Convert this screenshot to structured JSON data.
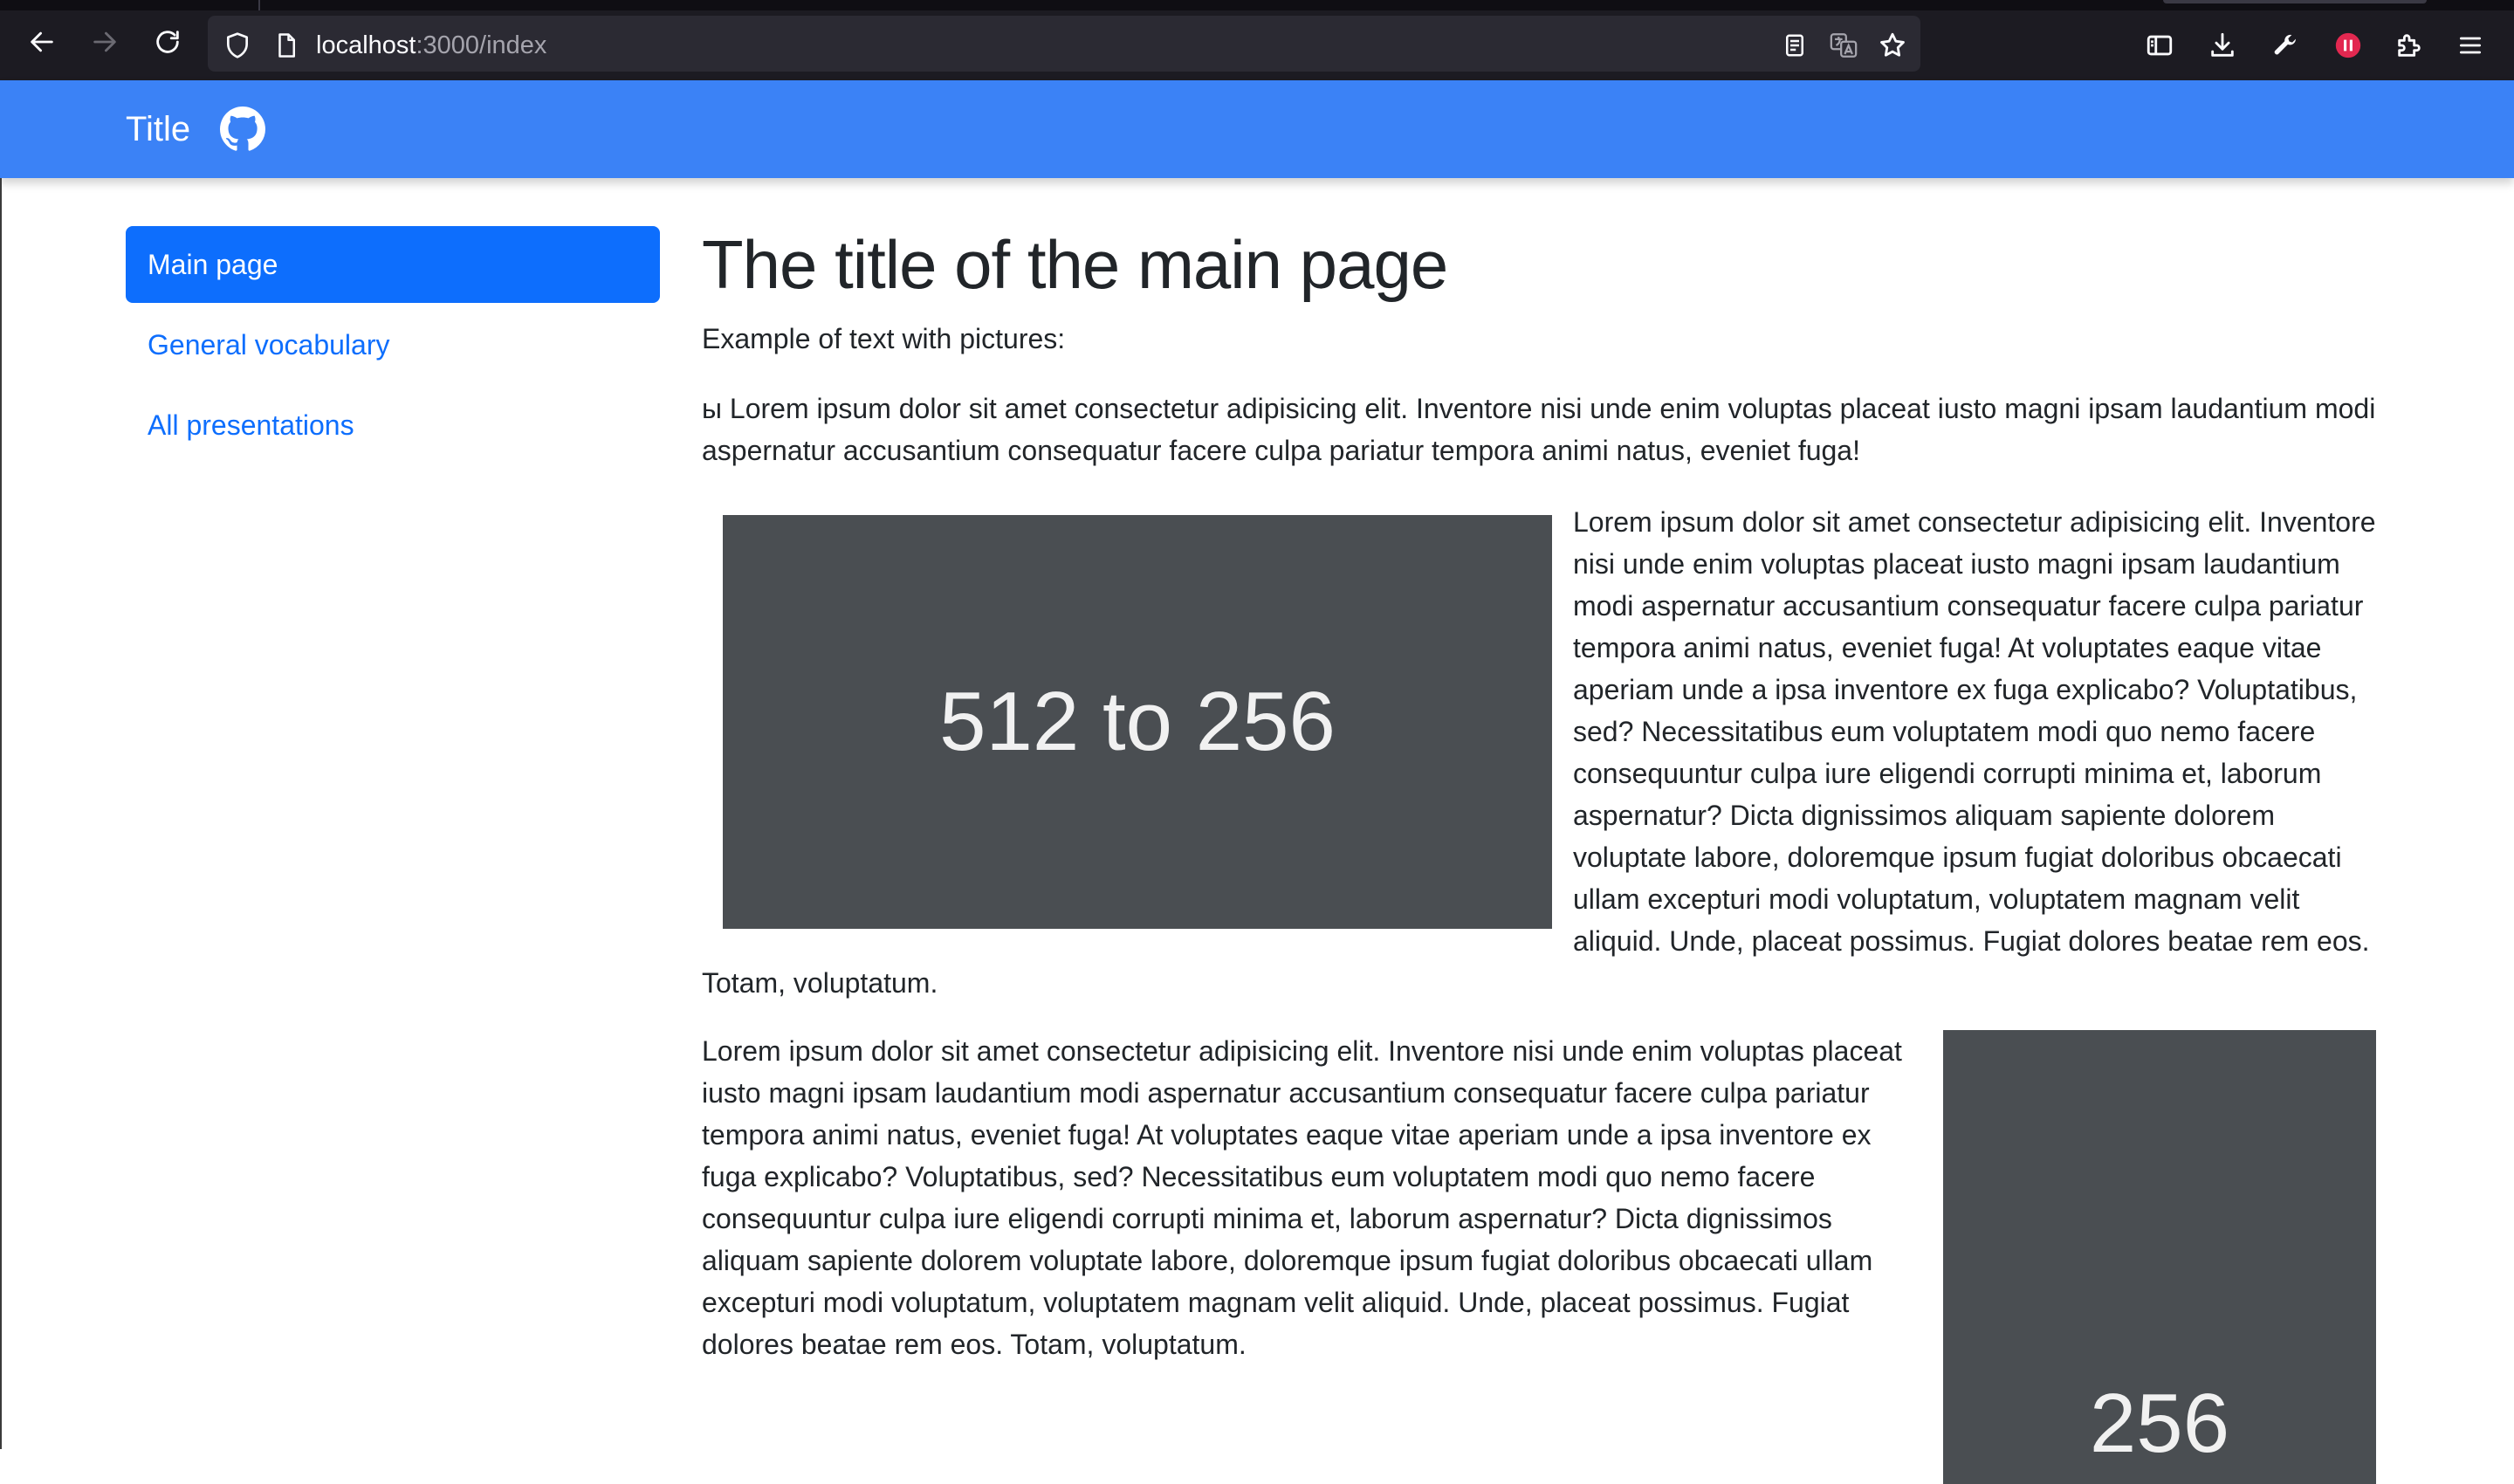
{
  "browser": {
    "url_host": "localhost",
    "url_rest": ":3000/index",
    "icons": [
      "back-icon",
      "forward-icon",
      "reload-icon",
      "shield-icon",
      "page-icon",
      "reader-view-icon",
      "translate-icon",
      "bookmark-star-icon",
      "sidebar-icon",
      "download-icon",
      "wrench-icon",
      "record-icon",
      "extensions-icon",
      "menu-icon"
    ]
  },
  "header": {
    "brand": "Title",
    "icon": "github-icon",
    "color": "#3b82f6"
  },
  "sidebar": {
    "items": [
      {
        "label": "Main page",
        "active": true
      },
      {
        "label": "General vocabulary",
        "active": false
      },
      {
        "label": "All presentations",
        "active": false
      }
    ]
  },
  "main": {
    "title": "The title of the main page",
    "intro": "Example of text with pictures:",
    "para1": "ы Lorem ipsum dolor sit amet consectetur adipisicing elit. Inventore nisi unde enim voluptas placeat iusto magni ipsam laudantium modi aspernatur accusantium consequatur facere culpa pariatur tempora animi natus, eveniet fuga!",
    "image1_label": "512 to 256",
    "para2": "Lorem ipsum dolor sit amet consectetur adipisicing elit. Inventore nisi unde enim voluptas placeat iusto magni ipsam laudantium modi aspernatur accusantium consequatur facere culpa pariatur tempora animi natus, eveniet fuga! At voluptates eaque vitae aperiam unde a ipsa inventore ex fuga explicabo? Voluptatibus, sed? Necessitatibus eum voluptatem modi quo nemo facere consequuntur culpa iure eligendi corrupti minima et, laborum aspernatur? Dicta dignissimos aliquam sapiente dolorem voluptate labore, doloremque ipsum fugiat doloribus obcaecati ullam excepturi modi voluptatum, voluptatem magnam velit aliquid. Unde, placeat possimus. Fugiat dolores beatae rem eos. Totam, voluptatum.",
    "image2_label": "256",
    "para3": "Lorem ipsum dolor sit amet consectetur adipisicing elit. Inventore nisi unde enim voluptas placeat iusto magni ipsam laudantium modi aspernatur accusantium consequatur facere culpa pariatur tempora animi natus, eveniet fuga! At voluptates eaque vitae aperiam unde a ipsa inventore ex fuga explicabo? Voluptatibus, sed? Necessitatibus eum voluptatem modi quo nemo facere consequuntur culpa iure eligendi corrupti minima et, laborum aspernatur? Dicta dignissimos aliquam sapiente dolorem voluptate labore, doloremque ipsum fugiat doloribus obcaecati ullam excepturi modi voluptatum, voluptatem magnam velit aliquid. Unde, placeat possimus. Fugiat dolores beatae rem eos. Totam, voluptatum."
  }
}
